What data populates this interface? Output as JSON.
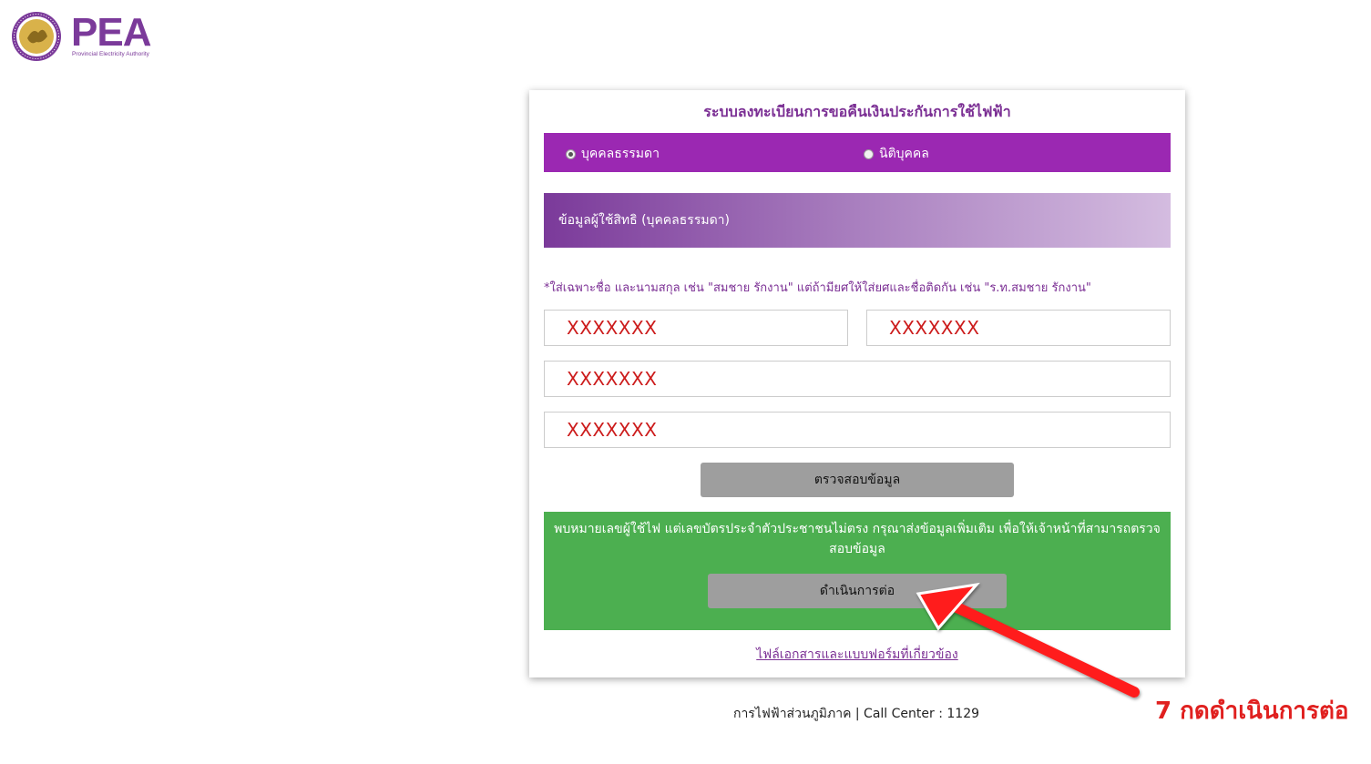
{
  "logo": {
    "text": "PEA",
    "subtitle": "Provincial Electricity Authority"
  },
  "form": {
    "title": "ระบบลงทะเบียนการขอคืนเงินประกันการใช้ไฟฟ้า",
    "radio_options": [
      {
        "label": "บุคคลธรรมดา",
        "checked": true
      },
      {
        "label": "นิติบุคคล",
        "checked": false
      }
    ],
    "section_heading": "ข้อมูลผู้ใช้สิทธิ (บุคคลธรรมดา)",
    "hint": "*ใส่เฉพาะชื่อ และนามสกุล เช่น \"สมชาย รักงาน\" แต่ถ้ามียศให้ใส่ยศและชื่อติดกัน เช่น \"ร.ท.สมชาย รักงาน\"",
    "fields": {
      "first_name": "XXXXXXX",
      "last_name": "XXXXXXX",
      "field_3": "XXXXXXX",
      "field_4": "XXXXXXX"
    },
    "check_button": "ตรวจสอบข้อมูล",
    "result_message": "พบหมายเลขผู้ใช้ไฟ แต่เลขบัตรประจำตัวประชาชนไม่ตรง กรุณาส่งข้อมูลเพิ่มเติม เพื่อให้เจ้าหน้าที่สามารถตรวจสอบข้อมูล",
    "continue_button": "ดำเนินการต่อ",
    "docs_link": "ไฟล์เอกสารและแบบฟอร์มที่เกี่ยวข้อง"
  },
  "footer": "การไฟฟ้าส่วนภูมิภาค | Call Center : 1129",
  "annotation": "7 กดดำเนินการต่อ",
  "colors": {
    "brand_purple": "#9b28b2",
    "success_green": "#4caf50",
    "annotation_red": "#e0201f"
  }
}
